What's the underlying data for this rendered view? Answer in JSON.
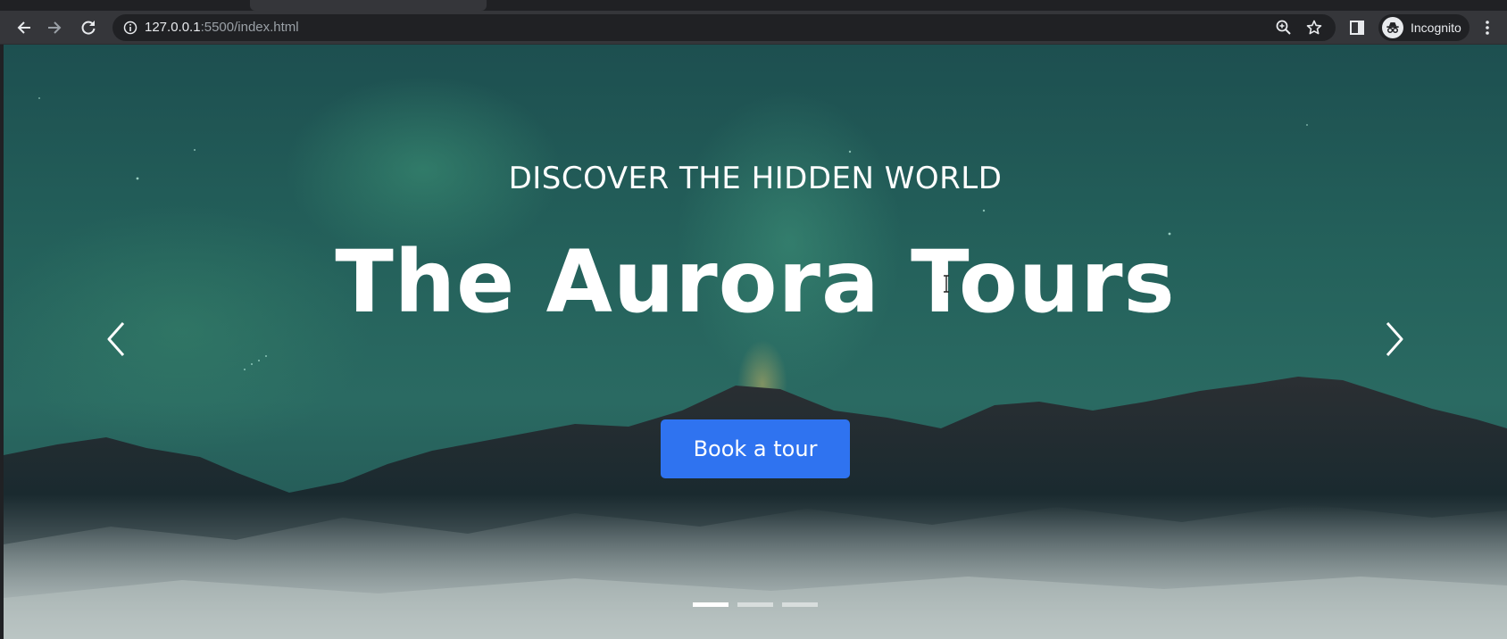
{
  "browser": {
    "url_host": "127.0.0.1",
    "url_rest": ":5500/index.html",
    "profile_label": "Incognito",
    "icons": {
      "back": "back-arrow-icon",
      "forward": "forward-arrow-icon",
      "reload": "reload-icon",
      "info": "site-info-icon",
      "zoom": "zoom-icon",
      "bookmark": "star-icon",
      "side_panel": "side-panel-icon",
      "incognito": "incognito-icon",
      "menu": "three-dot-menu-icon"
    }
  },
  "hero": {
    "kicker": "DISCOVER THE HIDDEN WORLD",
    "title": "The Aurora Tours",
    "cta_label": "Book a tour",
    "prev_icon": "chevron-left-icon",
    "next_icon": "chevron-right-icon",
    "indicators": {
      "count": 3,
      "active_index": 0
    }
  },
  "colors": {
    "cta": "#2f73f0",
    "chrome_toolbar": "#35363a",
    "chrome_omnibox": "#202124"
  }
}
